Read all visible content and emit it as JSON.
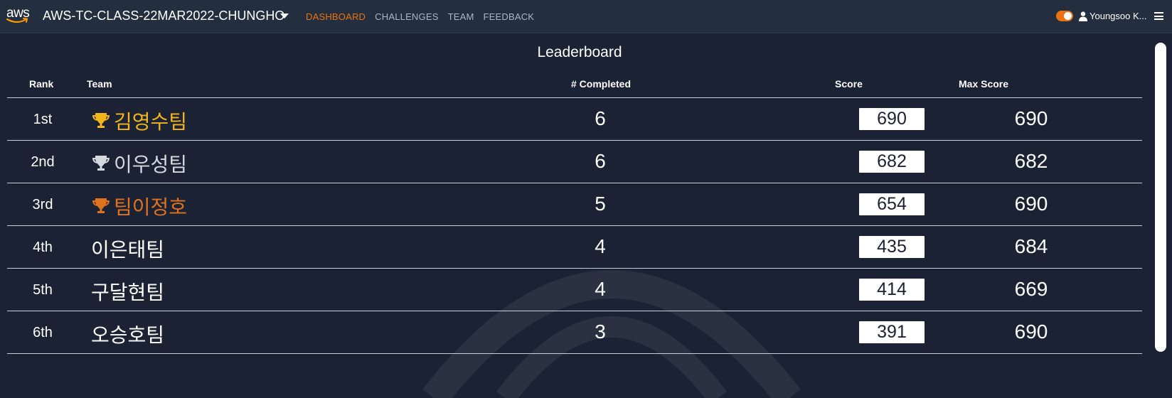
{
  "nav": {
    "logo_text": "aws",
    "event_title": "AWS-TC-CLASS-22MAR2022-CHUNGHO",
    "links": [
      {
        "label": "DASHBOARD",
        "active": true
      },
      {
        "label": "CHALLENGES",
        "active": false
      },
      {
        "label": "TEAM",
        "active": false
      },
      {
        "label": "FEEDBACK",
        "active": false
      }
    ],
    "theme_toggle_on": true,
    "user_name": "Youngsoo K...",
    "colors": {
      "bar": "#232f3e",
      "accent": "#ec7211"
    }
  },
  "leaderboard": {
    "title": "Leaderboard",
    "columns": {
      "rank": "Rank",
      "team": "Team",
      "completed": "# Completed",
      "score": "Score",
      "max_score": "Max Score"
    },
    "rows": [
      {
        "rank": "1st",
        "team": "김영수팀",
        "completed": "6",
        "score": "690",
        "max_score": "690",
        "trophy": "gold",
        "color": "#f2b51c"
      },
      {
        "rank": "2nd",
        "team": "이우성팀",
        "completed": "6",
        "score": "682",
        "max_score": "682",
        "trophy": "silver",
        "color": "#d5d9df"
      },
      {
        "rank": "3rd",
        "team": "팀이정호",
        "completed": "5",
        "score": "654",
        "max_score": "690",
        "trophy": "bronze",
        "color": "#e0711d"
      },
      {
        "rank": "4th",
        "team": "이은태팀",
        "completed": "4",
        "score": "435",
        "max_score": "684",
        "trophy": null,
        "color": "#ffffff"
      },
      {
        "rank": "5th",
        "team": "구달현팀",
        "completed": "4",
        "score": "414",
        "max_score": "669",
        "trophy": null,
        "color": "#ffffff"
      },
      {
        "rank": "6th",
        "team": "오승호팀",
        "completed": "3",
        "score": "391",
        "max_score": "690",
        "trophy": null,
        "color": "#ffffff"
      }
    ]
  },
  "icons": [
    "aws-logo-icon",
    "caret-down-icon",
    "toggle-icon",
    "user-icon",
    "hamburger-menu-icon",
    "trophy-icon"
  ]
}
